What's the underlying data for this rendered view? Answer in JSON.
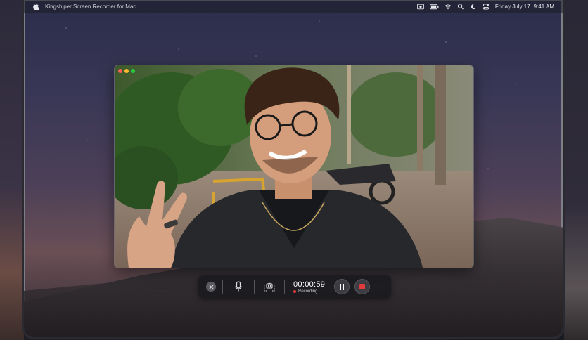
{
  "menubar": {
    "app_name": "Kingshiper Screen Recorder for Mac",
    "date": "Friday July 17",
    "time": "9:41 AM",
    "status_icons": [
      "screen-record-icon",
      "battery-icon",
      "wifi-icon",
      "spotlight-search-icon",
      "do-not-disturb-icon",
      "control-center-icon"
    ]
  },
  "preview": {
    "content": "webcam-photo"
  },
  "controls": {
    "timer": "00:00:59",
    "status": "Recording...",
    "buttons": [
      "close-button",
      "microphone-button",
      "screenshot-button",
      "pause-button",
      "stop-button"
    ]
  },
  "colors": {
    "record_red": "#e23a3a",
    "traffic_red": "#ff5f57",
    "traffic_yellow": "#febc2e",
    "traffic_green": "#28c840"
  }
}
